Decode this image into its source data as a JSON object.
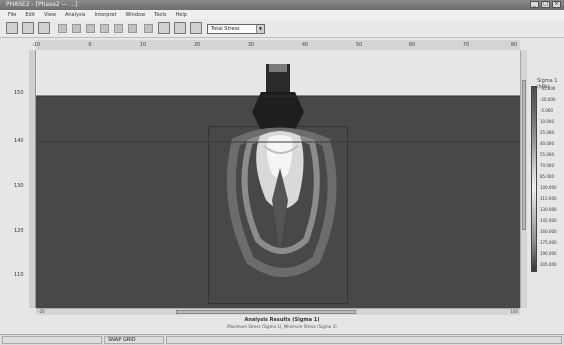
{
  "window": {
    "title": "PHASE2 - [Phase2 — ...]"
  },
  "menu": [
    "File",
    "Edit",
    "View",
    "Analysis",
    "Interpret",
    "Window",
    "Tools",
    "Help"
  ],
  "toolbar": {
    "combo_value": "Total Stress",
    "icons": [
      "new-icon",
      "open-icon",
      "save-icon",
      "cut-icon",
      "copy-icon",
      "paste-icon",
      "print-icon",
      "undo-icon",
      "redo-icon",
      "zoom-icon",
      "pan-icon",
      "select-icon",
      "chart-icon",
      "pencil-icon"
    ]
  },
  "x_ticks": [
    "-10",
    "0",
    "10",
    "20",
    "30",
    "40",
    "50",
    "60",
    "70",
    "80"
  ],
  "y_ticks": [
    "150",
    "140",
    "130",
    "120",
    "110"
  ],
  "legend": {
    "title": "Sigma 1 (kPa)",
    "values": [
      "-35.000",
      "-20.000",
      "-5.000",
      "10.000",
      "25.000",
      "40.000",
      "55.000",
      "70.000",
      "85.000",
      "100.000",
      "115.000",
      "130.000",
      "145.000",
      "160.000",
      "175.000",
      "190.000",
      "205.000"
    ]
  },
  "caption": {
    "line1": "Analysis Results (Sigma 1)",
    "line2": "Maximum Stress (Sigma 1), Minimum Stress (Sigma 3)"
  },
  "scroll": {
    "left_label": "-20",
    "right_label": "100"
  },
  "status": {
    "left": "",
    "middle": "SNAP  GRID"
  }
}
